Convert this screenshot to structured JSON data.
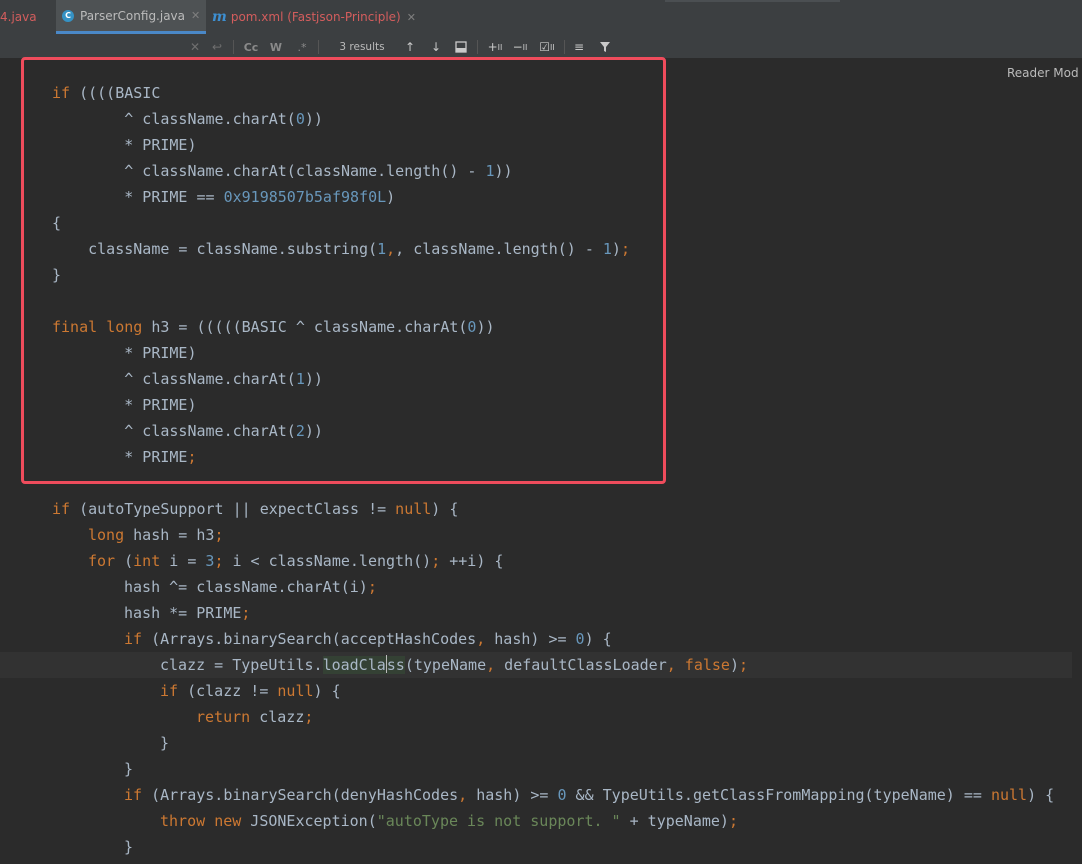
{
  "tabs": [
    {
      "label": "4.java",
      "active": false
    },
    {
      "label": "ParserConfig.java",
      "active": true,
      "icon": "java-class-icon"
    },
    {
      "label": "pom.xml (Fastjson-Principle)",
      "active": false,
      "icon": "maven-icon"
    }
  ],
  "findbar": {
    "match_case": "Cc",
    "words": "W",
    "regex": ".*",
    "results": "3 results"
  },
  "reader_mode": "Reader Mod",
  "colors": {
    "keyword": "#cc7832",
    "number": "#6897bb",
    "string": "#6a8759",
    "text": "#a9b7c6",
    "highlight_border": "#ef4c5c"
  },
  "code": {
    "l1": {
      "a": "if",
      "b": " ((((BASIC"
    },
    "l2": {
      "a": "        ^ className.charAt(",
      "n": "0",
      "b": "))"
    },
    "l3": {
      "a": "        * PRIME)"
    },
    "l4": {
      "a": "        ^ className.charAt(className.length() - ",
      "n": "1",
      "b": "))"
    },
    "l5": {
      "a": "        * PRIME == ",
      "n": "0x9198507b5af98f0L",
      "b": ")"
    },
    "l6": {
      "a": "{"
    },
    "l7": {
      "a": "    className = className.substring(",
      "n1": "1",
      "c": ", className.length() - ",
      "n2": "1",
      "b": ")",
      "p": ";"
    },
    "l8": {
      "a": "}"
    },
    "l9": {
      "k1": "final",
      "k2": "long",
      "a": " h3 = (((((BASIC ^ className.charAt(",
      "n": "0",
      "b": "))"
    },
    "l10": {
      "a": "        * PRIME)"
    },
    "l11": {
      "a": "        ^ className.charAt(",
      "n": "1",
      "b": "))"
    },
    "l12": {
      "a": "        * PRIME)"
    },
    "l13": {
      "a": "        ^ className.charAt(",
      "n": "2",
      "b": "))"
    },
    "l14": {
      "a": "        * PRIME",
      "p": ";"
    },
    "l15": {
      "k": "if",
      "a": " (autoTypeSupport || expectClass != ",
      "k2": "null",
      "b": ") {"
    },
    "l16": {
      "k": "long",
      "a": " hash = h3",
      "p": ";"
    },
    "l17": {
      "k": "for",
      "a": " (",
      "k2": "int",
      "b": " i = ",
      "n": "3",
      "p1": ";",
      "c": " i < className.length()",
      "p2": ";",
      "d": " ++i) {"
    },
    "l18": {
      "a": "hash ^= className.charAt(i)",
      "p": ";"
    },
    "l19": {
      "a": "hash *= PRIME",
      "p": ";"
    },
    "l20": {
      "k": "if",
      "a": " (Arrays.binarySearch(acceptHashCodes",
      "p": ",",
      "b": " hash) >= ",
      "n": "0",
      "c": ") {"
    },
    "l21": {
      "a": "clazz = TypeUtils.",
      "m1": "loadCla",
      "m2": "ss",
      "b": "(typeName",
      "p1": ",",
      "c": " defaultClassLoader",
      "p2": ",",
      "k": " false",
      "d": ")",
      "p3": ";"
    },
    "l22": {
      "k": "if",
      "a": " (clazz != ",
      "k2": "null",
      "b": ") {"
    },
    "l23": {
      "k": "return",
      "a": " clazz",
      "p": ";"
    },
    "l24": {
      "a": "}"
    },
    "l25": {
      "a": "}"
    },
    "l26": {
      "k": "if",
      "a": " (Arrays.binarySearch(denyHashCodes",
      "p": ",",
      "b": " hash) >= ",
      "n": "0",
      "c": " && TypeUtils.getClassFromMapping(typeName) == ",
      "k2": "null",
      "d": ") {"
    },
    "l27": {
      "k": "throw",
      "k2": "new",
      "a": " JSONException(",
      "s": "\"autoType is not support. \"",
      "b": " + typeName)",
      "p": ";"
    },
    "l28": {
      "a": "}"
    }
  }
}
